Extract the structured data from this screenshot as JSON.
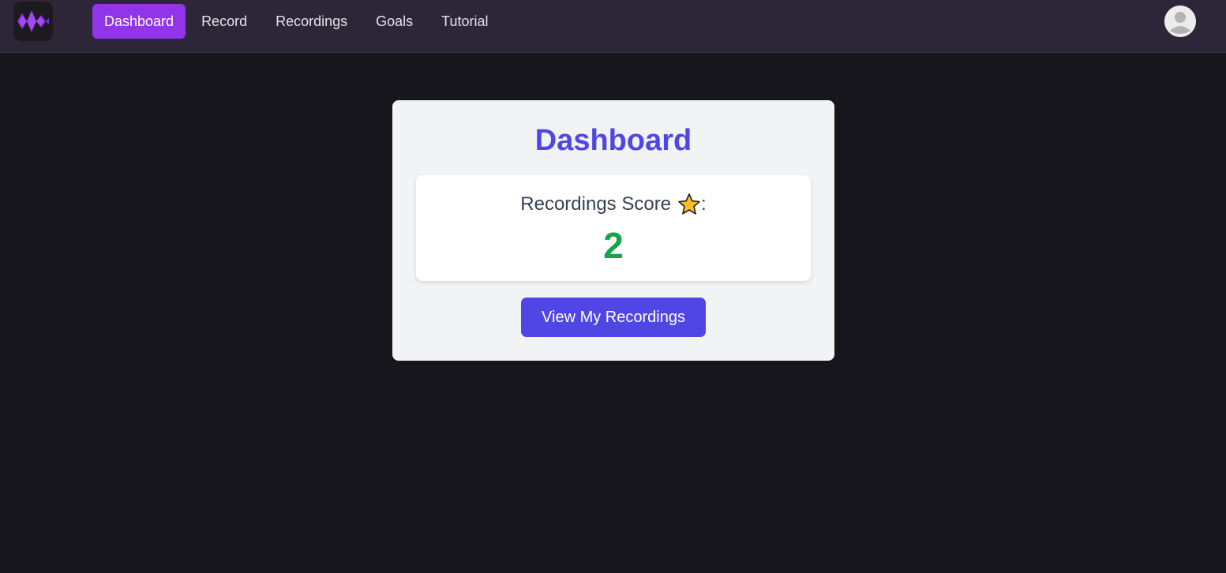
{
  "nav": {
    "items": [
      {
        "label": "Dashboard",
        "active": true
      },
      {
        "label": "Record",
        "active": false
      },
      {
        "label": "Recordings",
        "active": false
      },
      {
        "label": "Goals",
        "active": false
      },
      {
        "label": "Tutorial",
        "active": false
      }
    ]
  },
  "dashboard": {
    "title": "Dashboard",
    "score_label": "Recordings Score",
    "score_suffix": ":",
    "score_value": "2",
    "view_button_label": "View My Recordings"
  },
  "colors": {
    "page_bg": "#18161d",
    "navbar_bg": "#2d2639",
    "active_nav": "#9134ea",
    "brand_indigo": "#4f46e5",
    "score_green": "#16a34a",
    "star_yellow": "#fbbf24"
  },
  "icons": {
    "logo": "waveform-logo-icon",
    "avatar": "user-avatar-icon",
    "score": "star-icon"
  }
}
